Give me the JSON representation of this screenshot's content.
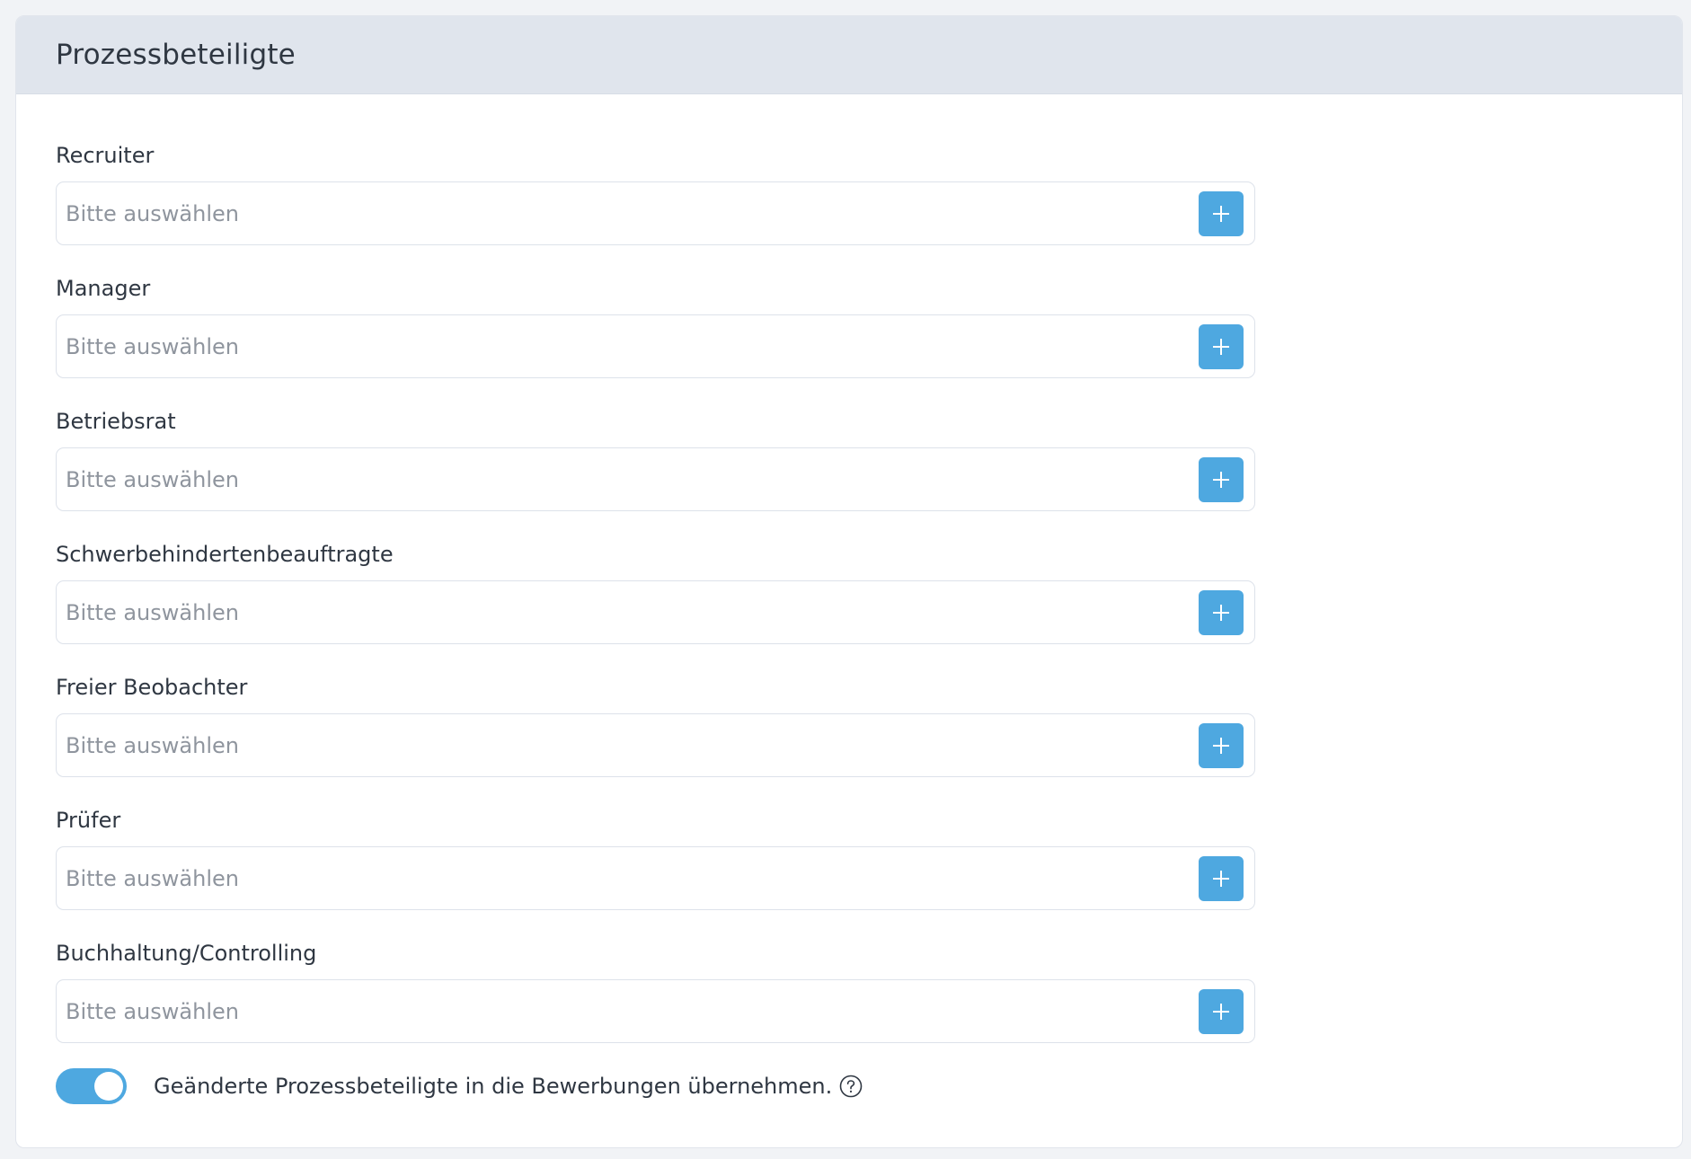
{
  "card": {
    "title": "Prozessbeteiligte"
  },
  "fields": [
    {
      "label": "Recruiter",
      "placeholder": "Bitte auswählen",
      "value": ""
    },
    {
      "label": "Manager",
      "placeholder": "Bitte auswählen",
      "value": ""
    },
    {
      "label": "Betriebsrat",
      "placeholder": "Bitte auswählen",
      "value": ""
    },
    {
      "label": "Schwerbehindertenbeauftragte",
      "placeholder": "Bitte auswählen",
      "value": ""
    },
    {
      "label": "Freier Beobachter",
      "placeholder": "Bitte auswählen",
      "value": ""
    },
    {
      "label": "Prüfer",
      "placeholder": "Bitte auswählen",
      "value": ""
    },
    {
      "label": "Buchhaltung/Controlling",
      "placeholder": "Bitte auswählen",
      "value": ""
    }
  ],
  "add_button_icon": "plus-icon",
  "toggle": {
    "label": "Geänderte Prozessbeteiligte in die Bewerbungen übernehmen.",
    "checked": true,
    "help_icon": "question-circle-icon"
  },
  "colors": {
    "accent": "#4ea8e0",
    "header_background": "#e0e5ed",
    "page_background": "#f1f3f6",
    "text": "#2f3742",
    "placeholder": "#8f959e"
  }
}
